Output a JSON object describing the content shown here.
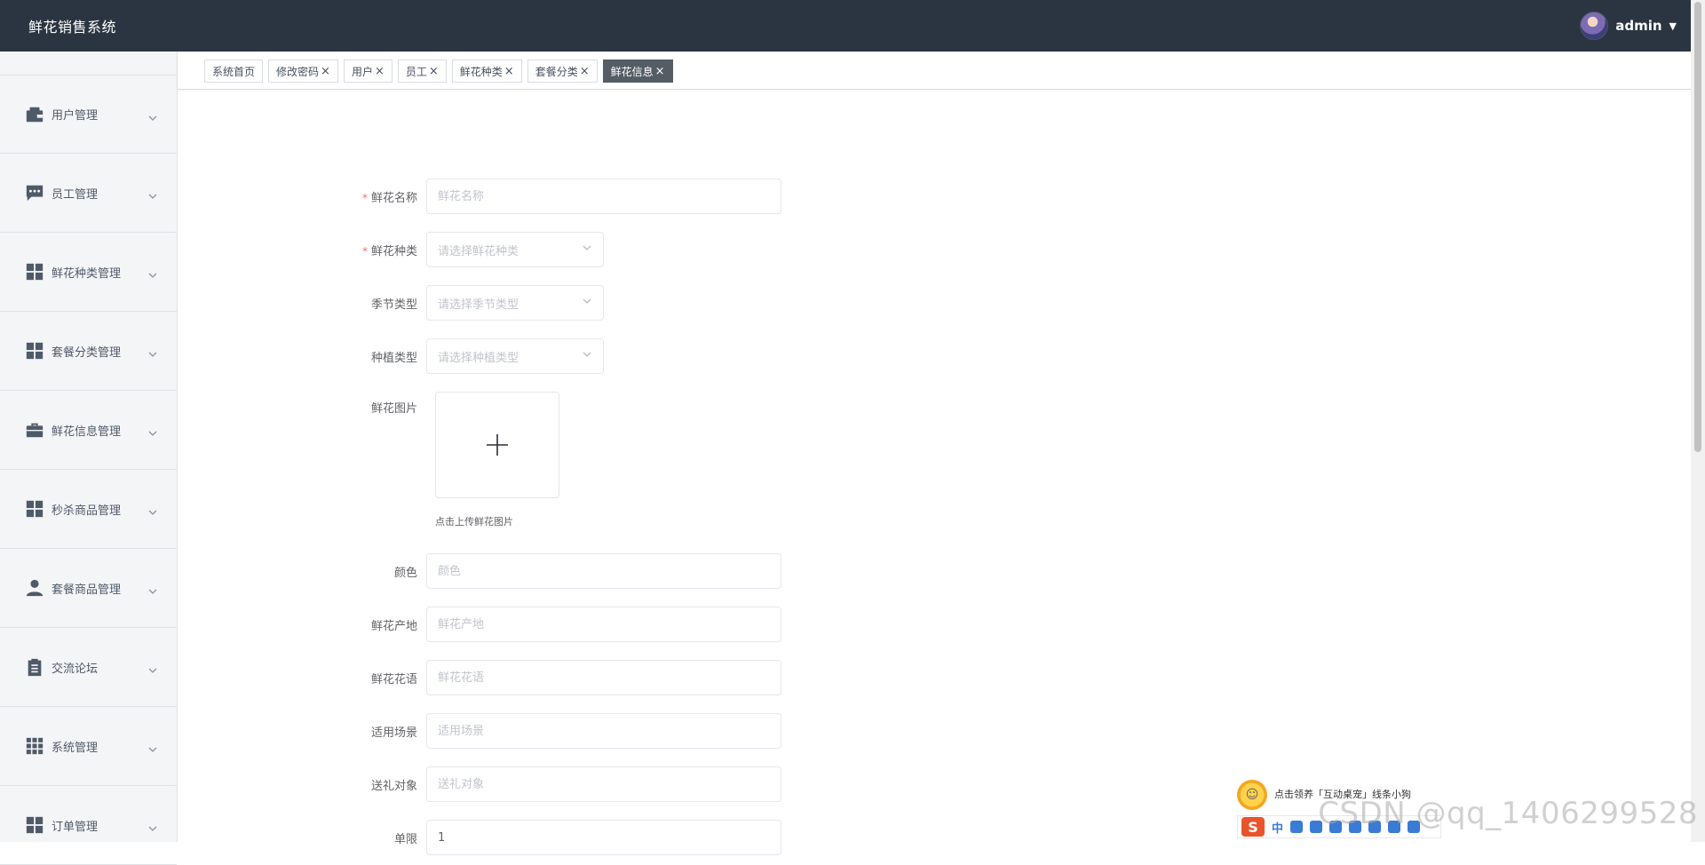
{
  "app": {
    "title": "鲜花销售系统"
  },
  "user": {
    "name": "admin"
  },
  "sidebar": {
    "items": [
      {
        "label": "用户管理",
        "icon": "wallet-icon"
      },
      {
        "label": "员工管理",
        "icon": "chat-icon"
      },
      {
        "label": "鲜花种类管理",
        "icon": "grid-icon"
      },
      {
        "label": "套餐分类管理",
        "icon": "grid-icon"
      },
      {
        "label": "鲜花信息管理",
        "icon": "briefcase-icon"
      },
      {
        "label": "秒杀商品管理",
        "icon": "grid-icon"
      },
      {
        "label": "套餐商品管理",
        "icon": "person-icon"
      },
      {
        "label": "交流论坛",
        "icon": "clipboard-icon"
      },
      {
        "label": "系统管理",
        "icon": "apps-icon"
      },
      {
        "label": "订单管理",
        "icon": "grid-icon"
      }
    ]
  },
  "tabs": [
    {
      "label": "系统首页",
      "closable": false,
      "active": false
    },
    {
      "label": "修改密码",
      "closable": true,
      "active": false
    },
    {
      "label": "用户",
      "closable": true,
      "active": false
    },
    {
      "label": "员工",
      "closable": true,
      "active": false
    },
    {
      "label": "鲜花种类",
      "closable": true,
      "active": false
    },
    {
      "label": "套餐分类",
      "closable": true,
      "active": false
    },
    {
      "label": "鲜花信息",
      "closable": true,
      "active": true
    }
  ],
  "form": {
    "name": {
      "label": "鲜花名称",
      "placeholder": "鲜花名称",
      "required": true
    },
    "category": {
      "label": "鲜花种类",
      "placeholder": "请选择鲜花种类",
      "required": true
    },
    "season": {
      "label": "季节类型",
      "placeholder": "请选择季节类型"
    },
    "planting": {
      "label": "种植类型",
      "placeholder": "请选择种植类型"
    },
    "image": {
      "label": "鲜花图片",
      "hint": "点击上传鲜花图片"
    },
    "color": {
      "label": "颜色",
      "placeholder": "颜色"
    },
    "origin": {
      "label": "鲜花产地",
      "placeholder": "鲜花产地"
    },
    "language": {
      "label": "鲜花花语",
      "placeholder": "鲜花花语"
    },
    "scene": {
      "label": "适用场景",
      "placeholder": "适用场景"
    },
    "recipient": {
      "label": "送礼对象",
      "placeholder": "送礼对象"
    },
    "limit": {
      "label": "单限",
      "value": "1"
    }
  },
  "overlay": {
    "watermark": "CSDN @qq_1406299528",
    "ime_tip": "点击领养「互动桌宠」线条小狗",
    "ime_cn": "中"
  },
  "colors": {
    "header_bg": "#2b3541",
    "sidebar_bg": "#f4f5f7",
    "tab_active_bg": "#545c64",
    "required": "#f56c6c"
  }
}
